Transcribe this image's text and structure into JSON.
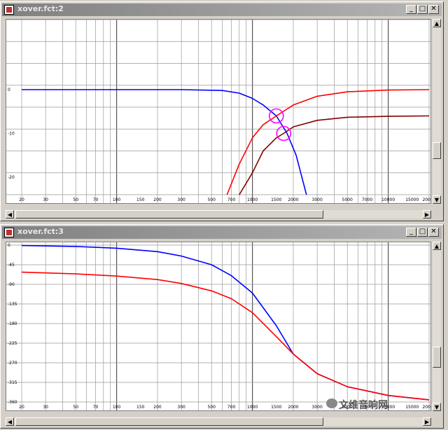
{
  "windows": [
    {
      "title": "xover.fct:2",
      "buttons": {
        "minimize": "_",
        "maximize": "□",
        "close": "✕"
      },
      "chart_data": {
        "type": "line",
        "x_scale": "log",
        "xlim": [
          20,
          20000
        ],
        "ylim": [
          -24,
          16
        ],
        "x_ticks": [
          "20",
          "30",
          "50",
          "70",
          "100",
          "150",
          "200",
          "300",
          "500",
          "700",
          "1000",
          "1500",
          "2000",
          "3000",
          "5000",
          "7000",
          "10000",
          "15000",
          "20000"
        ],
        "y_ticks": [
          "0",
          "-10",
          "-20"
        ],
        "y_tick_values": [
          0,
          -10,
          -20
        ],
        "grid": true,
        "series": [
          {
            "color": "#0000ff",
            "x": [
              20,
              300,
              600,
              800,
              1000,
              1200,
              1500,
              1800,
              2100,
              2500
            ],
            "y": [
              0,
              0,
              -0.2,
              -0.8,
              -2,
              -3.5,
              -6,
              -10,
              -15,
              -24
            ]
          },
          {
            "color": "#ff0000",
            "x": [
              650,
              800,
              1000,
              1200,
              1500,
              2000,
              3000,
              5000,
              10000,
              20000
            ],
            "y": [
              -24,
              -17,
              -11,
              -8,
              -6,
              -3.5,
              -1.5,
              -0.5,
              -0.1,
              0
            ]
          },
          {
            "color": "#800000",
            "x": [
              800,
              1000,
              1200,
              1500,
              1700,
              2000,
              3000,
              5000,
              10000,
              20000
            ],
            "y": [
              -24,
              -19,
              -14,
              -11,
              -10,
              -8.5,
              -7,
              -6.3,
              -6.1,
              -6
            ]
          }
        ],
        "markers": [
          {
            "color": "#ff00ff",
            "x": 1500,
            "y": -6
          },
          {
            "color": "#ff00ff",
            "x": 1700,
            "y": -10
          }
        ]
      }
    },
    {
      "title": "xover.fct:3",
      "buttons": {
        "minimize": "_",
        "maximize": "□",
        "close": "✕"
      },
      "chart_data": {
        "type": "line",
        "x_scale": "log",
        "xlim": [
          20,
          20000
        ],
        "ylim": [
          -360,
          0
        ],
        "x_ticks": [
          "20",
          "30",
          "50",
          "70",
          "100",
          "150",
          "200",
          "300",
          "500",
          "700",
          "1000",
          "1500",
          "2000",
          "3000",
          "5000",
          "7000",
          "10000",
          "15000",
          "20000"
        ],
        "y_ticks": [
          "0",
          "-45",
          "-90",
          "-135",
          "-180",
          "-225",
          "-270",
          "-315",
          "-360"
        ],
        "y_tick_values": [
          0,
          -45,
          -90,
          -135,
          -180,
          -225,
          -270,
          -315,
          -360
        ],
        "grid": true,
        "series": [
          {
            "color": "#0000ff",
            "x": [
              20,
              50,
              100,
              200,
              300,
              500,
              700,
              1000,
              1500,
              2000,
              3000,
              5000,
              10000,
              20000
            ],
            "y": [
              -1,
              -3,
              -7,
              -15,
              -25,
              -45,
              -70,
              -110,
              -185,
              -250,
              -295,
              -325,
              -345,
              -355
            ]
          },
          {
            "color": "#ff0000",
            "x": [
              20,
              50,
              100,
              200,
              300,
              500,
              700,
              1000,
              1500,
              2000,
              3000,
              5000,
              10000,
              20000
            ],
            "y": [
              -62,
              -66,
              -71,
              -79,
              -88,
              -105,
              -123,
              -155,
              -210,
              -250,
              -295,
              -325,
              -345,
              -355
            ]
          }
        ]
      }
    }
  ],
  "watermark": "文维音响网"
}
